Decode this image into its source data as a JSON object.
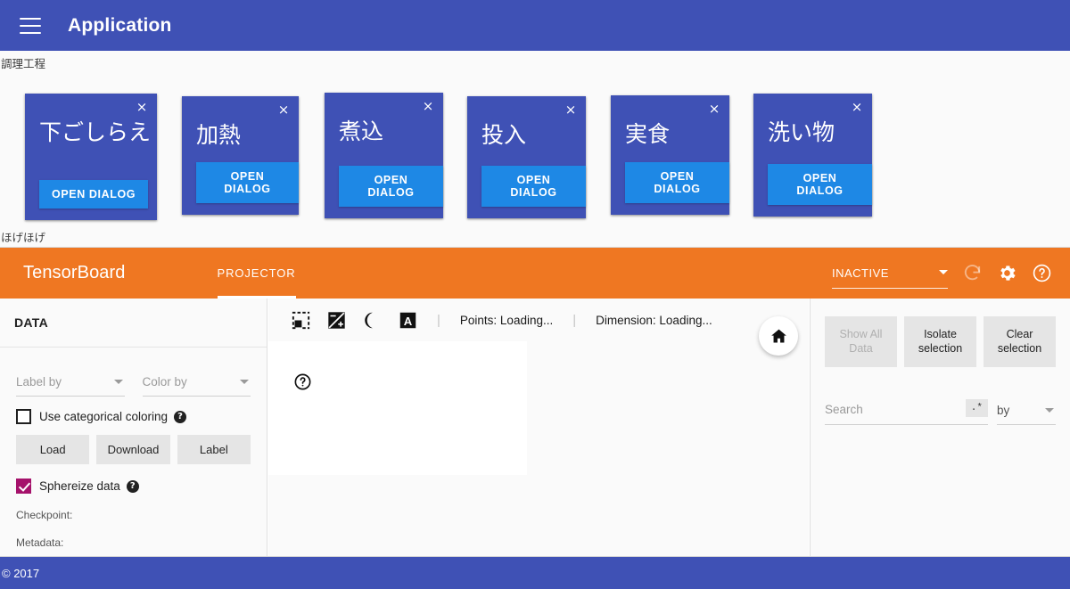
{
  "header": {
    "title": "Application",
    "menu_icon": "hamburger-menu-icon"
  },
  "sections": {
    "cards_label": "調理工程",
    "tensorboard_label": "ほげほげ"
  },
  "cards": [
    {
      "title": "下ごしらえ",
      "button": "OPEN DIALOG",
      "close": "×"
    },
    {
      "title": "加熱",
      "button": "OPEN DIALOG",
      "close": "×"
    },
    {
      "title": "煮込",
      "button": "OPEN DIALOG",
      "close": "×"
    },
    {
      "title": "投入",
      "button": "OPEN DIALOG",
      "close": "×"
    },
    {
      "title": "実食",
      "button": "OPEN DIALOG",
      "close": "×"
    },
    {
      "title": "洗い物",
      "button": "OPEN DIALOG",
      "close": "×"
    }
  ],
  "tensorboard": {
    "brand": "TensorBoard",
    "tab": "PROJECTOR",
    "run_selector": "INACTIVE",
    "icons": {
      "reload": "refresh-icon",
      "settings": "gear-icon",
      "help": "help-circle-icon"
    },
    "data_panel": {
      "heading": "DATA",
      "label_by": "Label by",
      "color_by": "Color by",
      "categorical_checkbox": "Use categorical coloring",
      "categorical_checked": false,
      "buttons": [
        "Load",
        "Download",
        "Label"
      ],
      "sphereize_checkbox": "Sphereize data",
      "sphereize_checked": true,
      "checkpoint": "Checkpoint:",
      "metadata": "Metadata:"
    },
    "canvas_toolbar": {
      "icons": [
        "selection-box-icon",
        "exposure-icon",
        "night-mode-icon",
        "labels-icon"
      ],
      "separator": "|",
      "points": "Points: Loading...",
      "dimension": "Dimension: Loading..."
    },
    "canvas": {
      "help_icon": "help-circle-icon",
      "home_icon": "home-icon"
    },
    "inspector": {
      "show_all": "Show All Data",
      "isolate": "Isolate selection",
      "clear": "Clear selection",
      "search_placeholder": "Search",
      "search_value": "",
      "regex_toggle": ".*",
      "by_label": "by"
    }
  },
  "footer": {
    "copyright": "© 2017"
  },
  "colors": {
    "primary": "#3f51b5",
    "card_button": "#1e88e5",
    "tensorboard_orange": "#ef7722",
    "checkbox_accent": "#a5126b"
  }
}
